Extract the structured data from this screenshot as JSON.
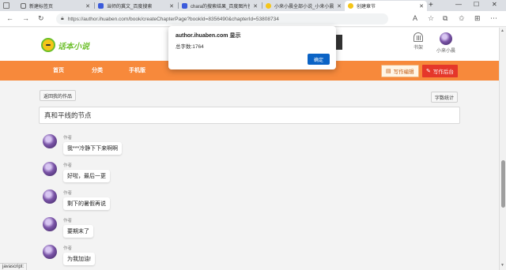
{
  "browser": {
    "tabs": [
      {
        "title": "新建标签页",
        "favicon_color": "#e8eaed"
      },
      {
        "title": "当师的冀文_百度搜索",
        "favicon_color": "#3b5bdb"
      },
      {
        "title": "chara的搜索结果_百度图片搜",
        "favicon_color": "#3b5bdb"
      },
      {
        "title": "小来小晨全部小说_小来小晨",
        "favicon_color": "#f5c518"
      },
      {
        "title": "创建章节",
        "favicon_color": "#f5c518"
      }
    ],
    "address": "https://author.ihuaben.com/book/createChapterPage?bookId=8356490&chapterId=53808734",
    "status_text": "javascript:"
  },
  "site": {
    "logo_text": "话本小说",
    "shelf_label": "书架",
    "user_name": "小来小晨",
    "nav": [
      "首页",
      "分类",
      "手机版"
    ],
    "write_edit_label": "写作编辑",
    "write_backend_label": "写作后台",
    "accent_color": "#f7893b"
  },
  "editor": {
    "back_button": "返回我的作品",
    "word_count_button": "字数统计",
    "chapter_title": "真和平线的节点",
    "messages": [
      {
        "author": "作者",
        "text": "我***冷静下下来啊啊"
      },
      {
        "author": "作者",
        "text": "好啦，最后一更"
      },
      {
        "author": "作者",
        "text": "剩下的暑假再说"
      },
      {
        "author": "作者",
        "text": "要期末了"
      },
      {
        "author": "作者",
        "text": "为我加油!"
      }
    ]
  },
  "dialog": {
    "title": "author.ihuaben.com 显示",
    "message": "总字数:1764",
    "ok_label": "确定"
  }
}
